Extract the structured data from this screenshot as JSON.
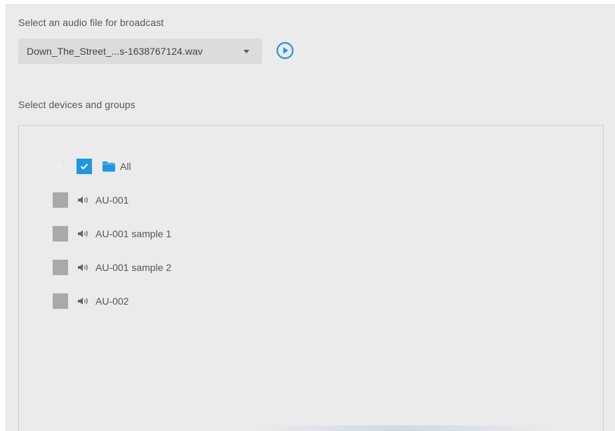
{
  "audio": {
    "label": "Select an audio file for broadcast",
    "selected_file": "Down_The_Street_...s-1638767124.wav",
    "play_icon": "play-circle-icon"
  },
  "devices": {
    "label": "Select devices and groups",
    "root": {
      "label": "All",
      "checked": true,
      "icon": "folder-icon"
    },
    "items": [
      {
        "label": "AU-001",
        "checked": false,
        "icon": "speaker-icon"
      },
      {
        "label": "AU-001 sample 1",
        "checked": false,
        "icon": "speaker-icon"
      },
      {
        "label": "AU-001 sample 2",
        "checked": false,
        "icon": "speaker-icon"
      },
      {
        "label": "AU-002",
        "checked": false,
        "icon": "speaker-icon"
      }
    ]
  },
  "colors": {
    "accent": "#2196e0",
    "unchecked": "#a9a9a9",
    "background": "#ebebeb"
  }
}
